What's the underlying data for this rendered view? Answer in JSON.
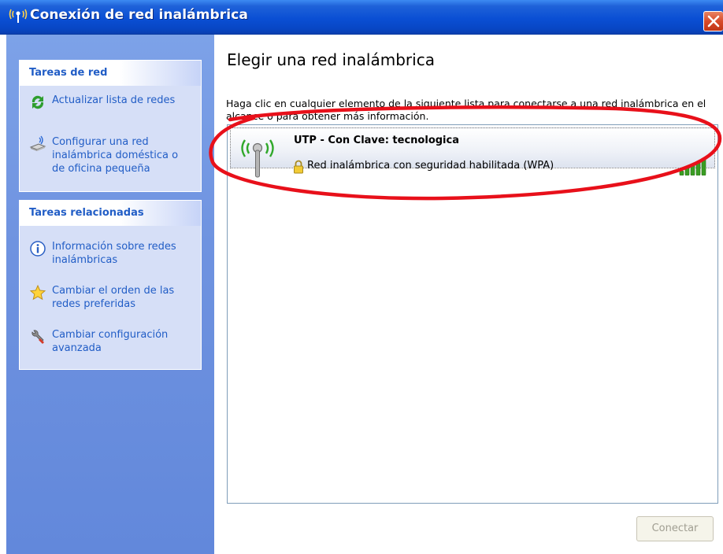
{
  "window": {
    "title": "Conexión de red inalámbrica",
    "title_icon": "wireless-network-icon",
    "close_icon": "close-icon"
  },
  "left_pane": {
    "network_tasks": {
      "header": "Tareas de red",
      "items": [
        {
          "label": "Actualizar lista de redes",
          "icon": "refresh-icon"
        },
        {
          "label": "Configurar una red inalámbrica doméstica o de oficina pequeña",
          "icon": "wireless-setup-icon"
        }
      ]
    },
    "related_tasks": {
      "header": "Tareas relacionadas",
      "items": [
        {
          "label": "Información sobre redes inalámbricas",
          "icon": "info-icon"
        },
        {
          "label": "Cambiar el orden de las redes preferidas",
          "icon": "star-icon"
        },
        {
          "label": "Cambiar configuración avanzada",
          "icon": "tools-icon"
        }
      ]
    }
  },
  "main": {
    "title": "Elegir una red inalámbrica",
    "description": "Haga clic en cualquier elemento de la siguiente lista para conectarse a una red inalámbrica en el alcance o para obtener más información.",
    "networks": [
      {
        "name": "UTP - Con Clave: tecnologica",
        "security": "Red inalámbrica con seguridad habilitada (WPA)",
        "signal_bars": 5,
        "signal_max": 5
      }
    ],
    "connect_button": "Conectar"
  },
  "colors": {
    "title_bar": "#0a4fd4",
    "task_pane": "#6f93e0",
    "task_link": "#215dc6",
    "highlight_ellipse": "#e8101a",
    "signal_green": "#3a9d23"
  }
}
